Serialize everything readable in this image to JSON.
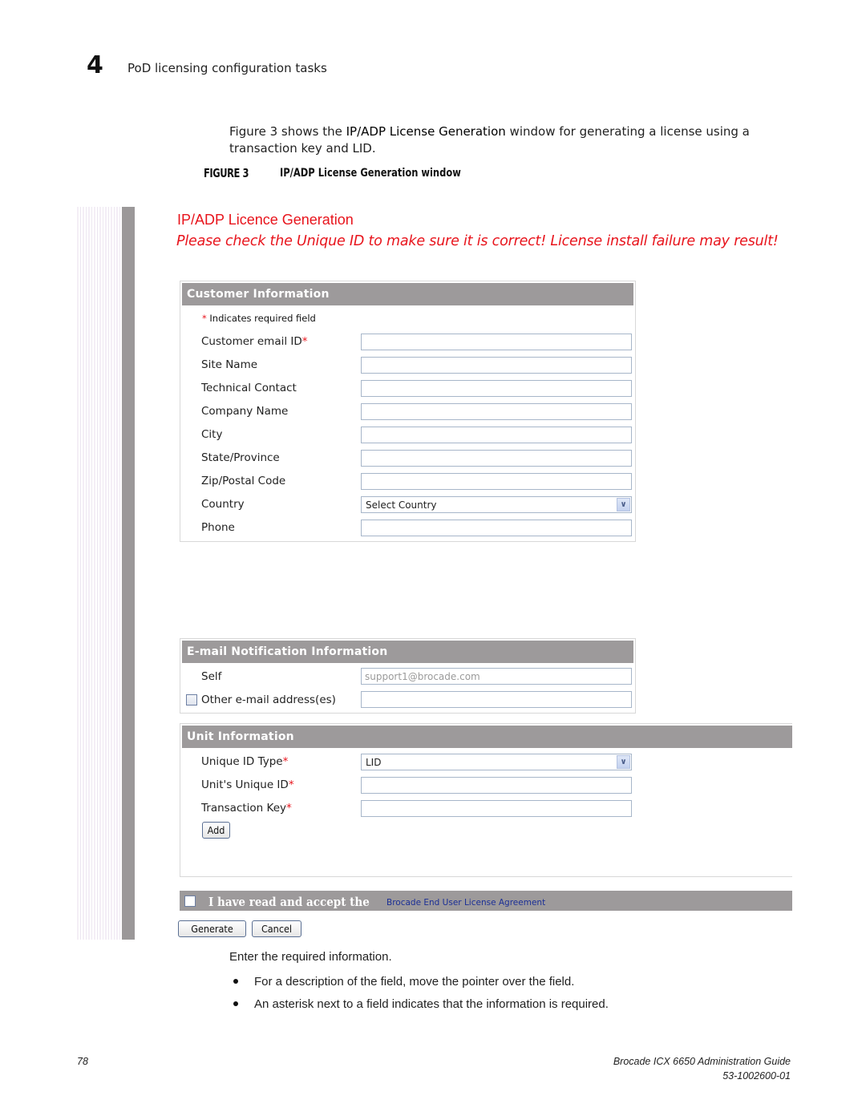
{
  "page_header": {
    "chapter_number": "4",
    "chapter_title": "PoD licensing configuration tasks"
  },
  "intro": {
    "prefix": "Figure 3 shows the ",
    "window_name": "IP/ADP License Generation",
    "suffix": " window for generating a license using a transaction key and LID."
  },
  "figure": {
    "label": "FIGURE 3",
    "caption": "IP/ADP License Generation window"
  },
  "app": {
    "title": "IP/ADP Licence Generation",
    "warning": "Please check the Unique ID to make sure it is correct! License install failure may result!"
  },
  "customer_info": {
    "header": "Customer Information",
    "required_note_star": "*",
    "required_note": " Indicates required field",
    "fields": [
      {
        "label": "Customer email ID",
        "required": "*",
        "value": ""
      },
      {
        "label": "Site Name",
        "required": "",
        "value": ""
      },
      {
        "label": "Technical Contact",
        "required": "",
        "value": ""
      },
      {
        "label": "Company Name",
        "required": "",
        "value": ""
      },
      {
        "label": "City",
        "required": "",
        "value": ""
      },
      {
        "label": "State/Province",
        "required": "",
        "value": ""
      },
      {
        "label": "Zip/Postal Code",
        "required": "",
        "value": ""
      },
      {
        "label": "Country",
        "required": "",
        "value": "Select Country",
        "type": "select"
      },
      {
        "label": "Phone",
        "required": "",
        "value": ""
      }
    ]
  },
  "email_info": {
    "header": "E-mail Notification Information",
    "self_label": "Self",
    "self_value": "support1@brocade.com",
    "other_label": "Other e-mail address(es)",
    "other_checked": false,
    "other_value": ""
  },
  "unit_info": {
    "header": "Unit Information",
    "fields": [
      {
        "label": "Unique ID Type",
        "required": "*",
        "value": "LID",
        "type": "select"
      },
      {
        "label": "Unit's Unique ID",
        "required": "*",
        "value": ""
      },
      {
        "label": "Transaction Key",
        "required": "*",
        "value": ""
      }
    ],
    "add_button": "Add"
  },
  "eula": {
    "checked": false,
    "text": "I have read and accept the ",
    "link": "Brocade End User License Agreement"
  },
  "actions": {
    "generate": "Generate",
    "cancel": "Cancel"
  },
  "instructions": {
    "step": "Enter the required information.",
    "bullets": [
      "For a description of the field, move the pointer over the field.",
      "An asterisk next to a field indicates that the information is required."
    ]
  },
  "footer": {
    "page_number": "78",
    "guide_title": "Brocade ICX 6650 Administration Guide",
    "doc_number": "53-1002600-01"
  },
  "colors": {
    "accent_red": "#e8141c",
    "header_gray": "#9d9a9b",
    "link_blue": "#1b2f96"
  }
}
